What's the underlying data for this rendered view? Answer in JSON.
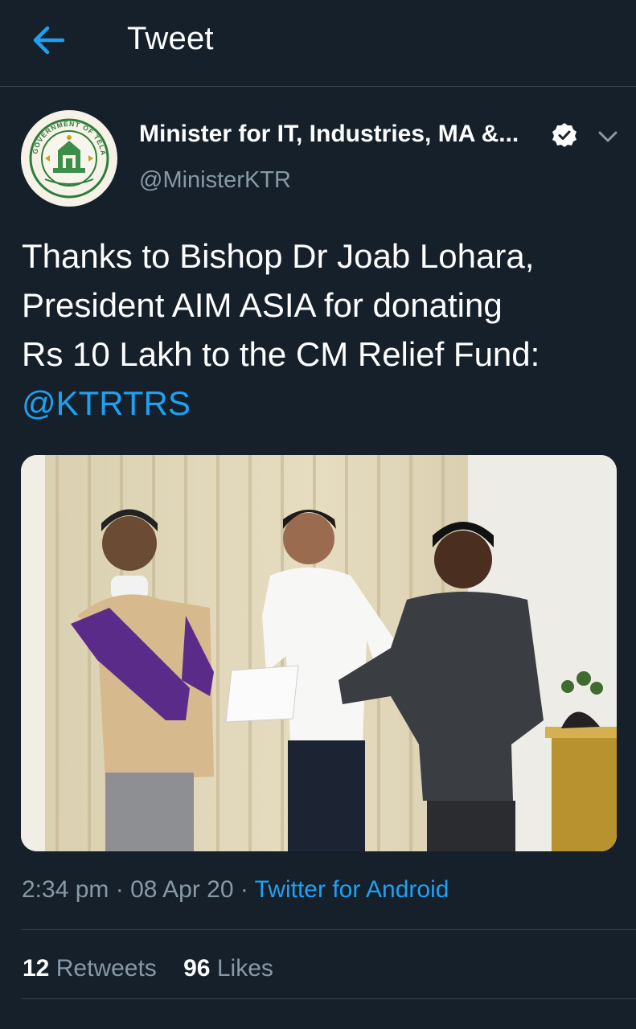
{
  "header": {
    "back_icon": "arrow-left-icon",
    "title": "Tweet",
    "accent": "#1da1f2",
    "background": "#15202b"
  },
  "author": {
    "name": "Minister for IT, Industries, MA &...",
    "handle": "@MinisterKTR",
    "avatar_icon": "government-of-telangana-emblem",
    "avatar_ring_text": "GOVERNMENT OF TELANGANA",
    "verified_icon": "verified-badge-icon",
    "menu_icon": "chevron-down-icon"
  },
  "tweet": {
    "lines": [
      "Thanks to Bishop Dr Joab Lohara,",
      "President AIM ASIA for donating",
      "Rs 10 Lakh to the CM Relief Fund:"
    ],
    "mention": "@KTRTRS",
    "photo_icon": "tweet-photo"
  },
  "meta": {
    "time": "2:34 pm",
    "sep1": " · ",
    "date": "08 Apr 20",
    "sep2": " · ",
    "source": "Twitter for Android"
  },
  "stats": {
    "retweets_count": "12",
    "retweets_label": "Retweets",
    "likes_count": "96",
    "likes_label": "Likes"
  }
}
